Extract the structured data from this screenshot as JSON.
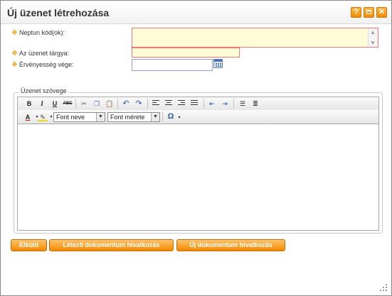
{
  "dialog": {
    "title": "Új üzenet létrehozása",
    "help_label": "?",
    "colors": {
      "accent": "#f08c00",
      "required_star": "#f39c12",
      "input_bg": "#fdfbd8",
      "input_border": "#f07878"
    }
  },
  "form": {
    "neptun_label": "Neptun kód(ok):",
    "neptun_value": "",
    "subject_label": "Az üzenet tárgya:",
    "subject_value": "",
    "expiry_label": "Érvényesség vége:",
    "expiry_value": ""
  },
  "editor": {
    "legend": "Üzenet szövege",
    "bold": "B",
    "italic": "I",
    "underline": "U",
    "strike": "ABC",
    "font_name": "Font neve",
    "font_size": "Font mérete",
    "special_char": "Ω"
  },
  "buttons": {
    "send": "Elküld",
    "existing_doc": "Létező dokumentum hivatkozás",
    "new_doc": "Új dokumentum hivatkozás"
  }
}
